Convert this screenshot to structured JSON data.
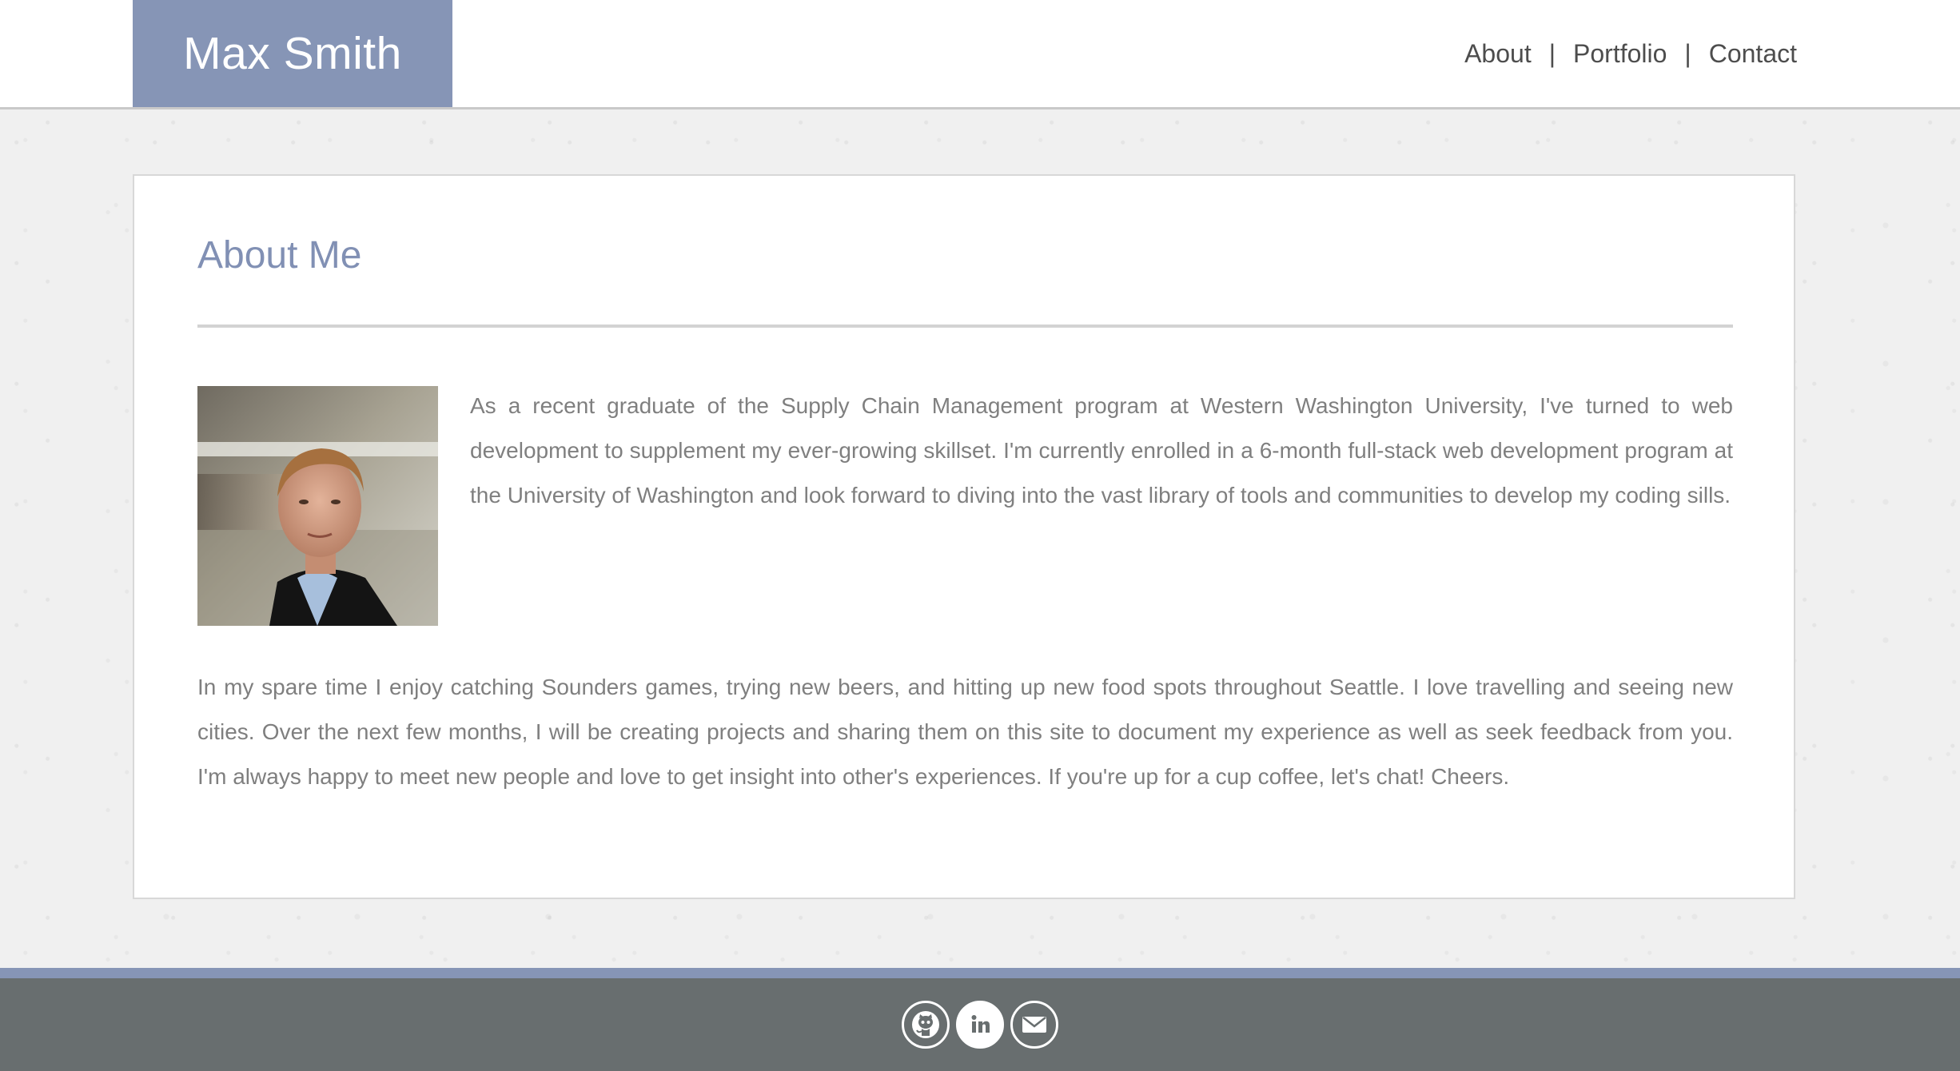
{
  "header": {
    "brand": "Max Smith",
    "nav": {
      "about": "About",
      "portfolio": "Portfolio",
      "contact": "Contact",
      "separator": "|"
    }
  },
  "about": {
    "title": "About Me",
    "photo_alt": "Portrait of Max Smith",
    "intro": "As a recent graduate of the Supply Chain Management program at Western Washington University, I've turned to web development to supplement my ever-growing skillset. I'm currently enrolled in a 6-month full-stack web development program at the University of Washington and look forward to diving into the vast library of tools and communities to develop my coding sills.",
    "spare_time": "In my spare time I enjoy catching Sounders games, trying new beers, and hitting up new food spots throughout Seattle. I love travelling and seeing new cities. Over the next few months, I will be creating projects and sharing them on this site to document my experience as well as seek feedback from you. I'm always happy to meet new people and love to get insight into other's experiences. If you're up for a cup coffee, let's chat! Cheers."
  },
  "footer": {
    "links": [
      {
        "icon": "github-icon"
      },
      {
        "icon": "linkedin-icon"
      },
      {
        "icon": "email-icon"
      }
    ]
  },
  "colors": {
    "accent": "#8695b6",
    "title": "#8190b4",
    "body_text": "#7f7f7f",
    "footer": "#686e6f"
  }
}
